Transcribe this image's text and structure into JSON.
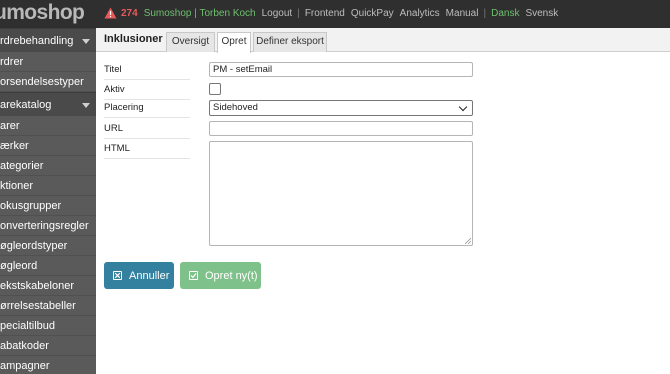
{
  "topbar": {
    "logo": "umoshop",
    "alert_count": "274",
    "shop_user": "Sumoshop | Torben Koch",
    "logout": "Logout",
    "links": [
      "Frontend",
      "QuickPay",
      "Analytics",
      "Manual"
    ],
    "languages": [
      "Dansk",
      "Svensk"
    ],
    "warning_color": "#e85a5a"
  },
  "sidebar": {
    "sections": [
      {
        "label": "rdrebehandling",
        "items": [
          "rdrer",
          "orsendelsestyper"
        ]
      },
      {
        "label": "arekatalog",
        "items": [
          "arer",
          "ærker",
          "ategorier",
          "ktioner",
          "okusgrupper",
          "onverteringsregler",
          "øgleordstyper",
          "øgleord",
          "ekstskabeloner",
          "ørrelsestabeller",
          "pecialtilbud",
          "abatkoder",
          "ampagner"
        ]
      }
    ]
  },
  "main": {
    "title": "Inklusioner",
    "tabs": [
      "Oversigt",
      "Opret",
      "Definer eksport"
    ],
    "active_tab": "Opret",
    "form": {
      "titel_label": "Titel",
      "titel_value": "PM - setEmail",
      "aktiv_label": "Aktiv",
      "placering_label": "Placering",
      "placering_value": "Sidehoved",
      "url_label": "URL",
      "url_value": "",
      "html_label": "HTML",
      "html_value": ""
    },
    "buttons": {
      "cancel": "Annuller",
      "create": "Opret ny(t)"
    }
  }
}
